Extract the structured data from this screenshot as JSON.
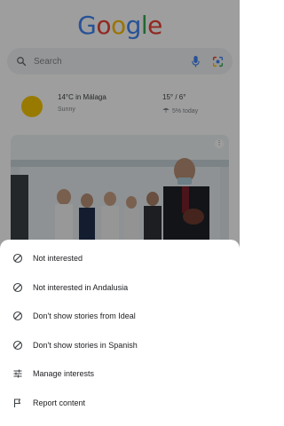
{
  "header": {
    "logo_letters": [
      "G",
      "o",
      "o",
      "g",
      "l",
      "e"
    ],
    "logo_colors": [
      "#4285F4",
      "#EA4335",
      "#FBBC05",
      "#4285F4",
      "#34A853",
      "#EA4335"
    ]
  },
  "search": {
    "placeholder": "Search"
  },
  "weather": {
    "title": "14°C in Málaga",
    "condition": "Sunny",
    "high_low": "15° / 6°",
    "precipitation": "5% today"
  },
  "menu": {
    "items": [
      {
        "label": "Not interested",
        "icon": "block-icon"
      },
      {
        "label": "Not interested in Andalusia",
        "icon": "block-icon"
      },
      {
        "label": "Don't show stories from Ideal",
        "icon": "block-icon"
      },
      {
        "label": "Don't show stories in Spanish",
        "icon": "block-icon"
      },
      {
        "label": "Manage interests",
        "icon": "tune-icon"
      },
      {
        "label": "Report content",
        "icon": "flag-icon"
      }
    ]
  },
  "colors": {
    "sun": "#F7C500",
    "mic_blue": "#4285F4",
    "scrim": "rgba(0,0,0,0.38)"
  }
}
